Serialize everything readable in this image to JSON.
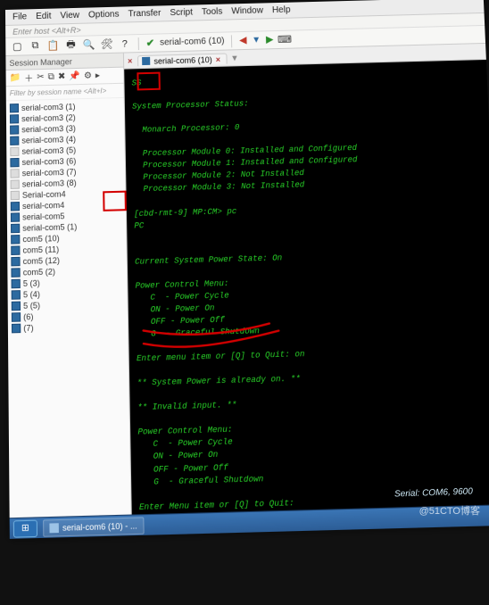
{
  "menu": {
    "items": [
      "File",
      "Edit",
      "View",
      "Options",
      "Transfer",
      "Script",
      "Tools",
      "Window",
      "Help"
    ],
    "hint": "Enter host <Alt+R>"
  },
  "toolbar": {
    "session_label": "serial-com6 (10)"
  },
  "status": {
    "connection": "Serial: COM6, 9600"
  },
  "session_manager": {
    "title": "Session Manager",
    "filter_placeholder": "Filter by session name <Alt+I>",
    "toolbar_icons": [
      "folder-icon",
      "plus-icon",
      "scissors-icon",
      "copy-icon",
      "paste-icon",
      "pin-icon",
      "gear-icon",
      "settings-icon"
    ],
    "items": [
      {
        "label": "serial-com3 (1)",
        "active": true
      },
      {
        "label": "serial-com3 (2)",
        "active": true
      },
      {
        "label": "serial-com3 (3)",
        "active": true
      },
      {
        "label": "serial-com3 (4)",
        "active": true
      },
      {
        "label": "serial-com3 (5)",
        "active": false
      },
      {
        "label": "serial-com3 (6)",
        "active": true
      },
      {
        "label": "serial-com3 (7)",
        "active": false
      },
      {
        "label": "serial-com3 (8)",
        "active": false
      },
      {
        "label": "Serial-com4",
        "active": false
      },
      {
        "label": "serial-com4",
        "active": true
      },
      {
        "label": "serial-com5",
        "active": true
      },
      {
        "label": "serial-com5 (1)",
        "active": true
      },
      {
        "label": "com5 (10)",
        "active": true
      },
      {
        "label": "com5 (11)",
        "active": true
      },
      {
        "label": "com5 (12)",
        "active": true
      },
      {
        "label": "com5 (2)",
        "active": true
      },
      {
        "label": "5 (3)",
        "active": true
      },
      {
        "label": "5 (4)",
        "active": true
      },
      {
        "label": "5 (5)",
        "active": true
      },
      {
        "label": "(6)",
        "active": true
      },
      {
        "label": "(7)",
        "active": true
      }
    ]
  },
  "tab": {
    "label": "serial-com6 (10)",
    "close_glyph": "×"
  },
  "terminal_output": {
    "lines": [
      "SS",
      "",
      "System Processor Status:",
      "",
      "  Monarch Processor: 0",
      "",
      "  Processor Module 0: Installed and Configured",
      "  Processor Module 1: Installed and Configured",
      "  Processor Module 2: Not Installed",
      "  Processor Module 3: Not Installed",
      "",
      "[cbd-rmt-9] MP:CM> pc",
      "PC",
      "",
      "",
      "Current System Power State: On",
      "",
      "Power Control Menu:",
      "   C  - Power Cycle",
      "   ON - Power On",
      "   OFF - Power Off",
      "   G  - Graceful Shutdown",
      "",
      "Enter menu item or [Q] to Quit: on",
      "",
      "** System Power is already on. **",
      "",
      "** Invalid input. **",
      "",
      "Power Control Menu:",
      "   C  - Power Cycle",
      "   ON - Power On",
      "   OFF - Power Off",
      "   G  - Graceful Shutdown",
      "",
      "Enter Menu item or [Q] to Quit: "
    ]
  },
  "taskbar": {
    "task_label": "serial-com6 (10) - ..."
  },
  "watermark": "@51CTO博客"
}
